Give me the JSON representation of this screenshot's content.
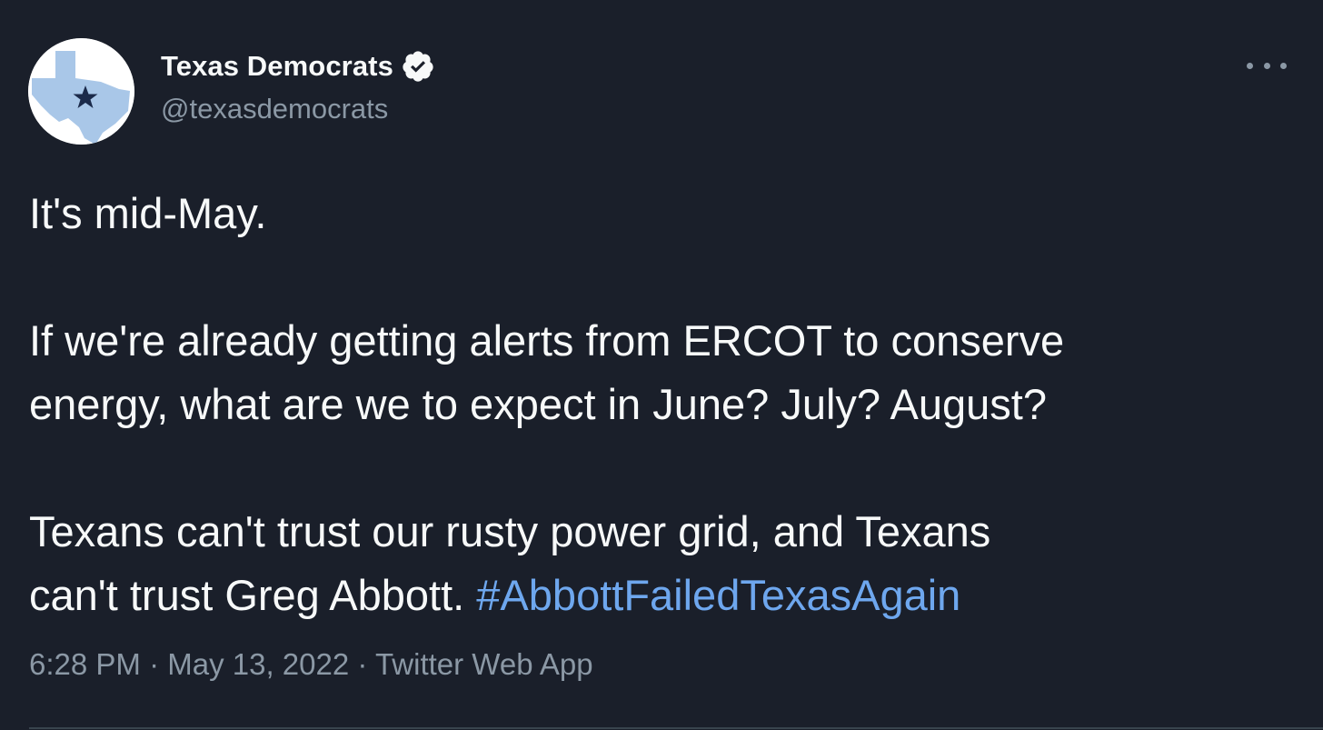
{
  "author": {
    "display_name": "Texas Democrats",
    "handle": "@texasdemocrats",
    "verified": true,
    "avatar_icon": "texas-star-icon"
  },
  "menu": {
    "icon": "more-options-icon"
  },
  "tweet": {
    "line1": "It's mid-May.",
    "para2_line1": "If we're already getting alerts from ERCOT to conserve",
    "para2_line2": "energy, what are we to expect in June? July? August?",
    "para3_line1": "Texans can't trust our rusty power grid, and Texans",
    "para3_line2_text": "can't trust Greg Abbott. ",
    "hashtag": "#AbbottFailedTexasAgain"
  },
  "meta": {
    "time": "6:28 PM",
    "date": "May 13, 2022",
    "separator": " · ",
    "source": "Twitter Web App"
  },
  "colors": {
    "background": "#1a1f2a",
    "text": "#f7f9f9",
    "muted": "#8b98a5",
    "link": "#6ea7ee"
  }
}
